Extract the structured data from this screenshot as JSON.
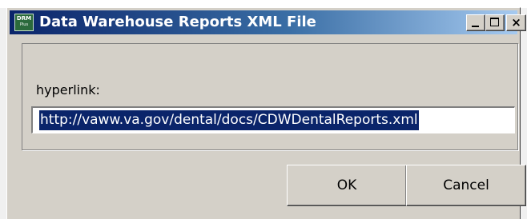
{
  "window": {
    "title": "Data Warehouse Reports XML File",
    "icon_name": "drm-app-icon",
    "icon_text": "DRM",
    "icon_subtext": "Plus",
    "controls": {
      "minimize_icon": "minimize-icon",
      "maximize_icon": "maximize-icon",
      "close_icon": "close-icon",
      "close_glyph": "×"
    }
  },
  "form": {
    "label": "hyperlink:",
    "value": "http://vaww.va.gov/dental/docs/CDWDentalReports.xml"
  },
  "buttons": {
    "ok_label": "OK",
    "cancel_label": "Cancel"
  },
  "colors": {
    "titlebar_start": "#0a246a",
    "titlebar_end": "#a6caf0",
    "selection": "#0a246a",
    "dialog_face": "#d4d0c8"
  }
}
